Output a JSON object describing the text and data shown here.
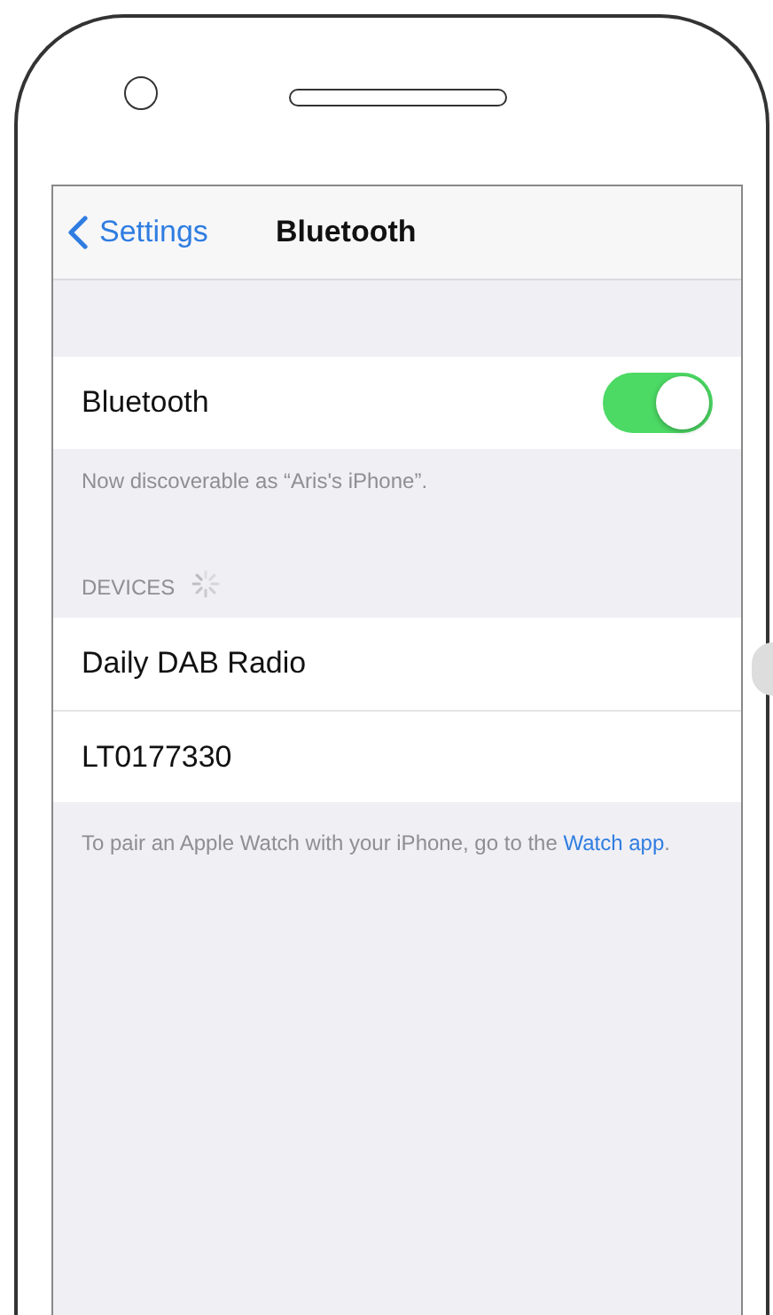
{
  "nav": {
    "back": "Settings",
    "title": "Bluetooth"
  },
  "bluetooth": {
    "label": "Bluetooth",
    "on": true,
    "note": "Now discoverable as “Aris's iPhone”."
  },
  "devices": {
    "header": "DEVICES",
    "searching": true,
    "items": [
      {
        "name": "Daily DAB Radio"
      },
      {
        "name": "LT0177330"
      }
    ]
  },
  "footer": {
    "text_before": "To pair an Apple Watch with your iPhone, go to the ",
    "link": "Watch app",
    "text_after": "."
  }
}
